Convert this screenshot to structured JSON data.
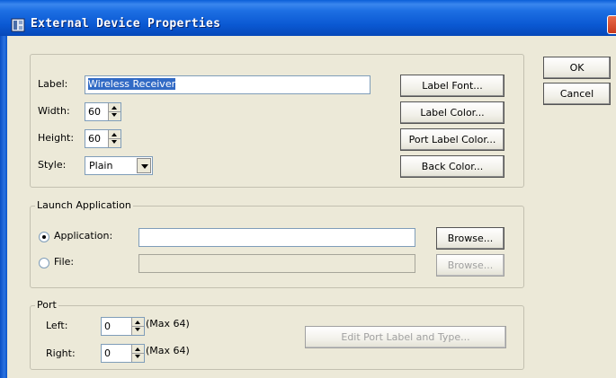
{
  "window": {
    "title": "External Device Properties",
    "ok_label": "OK",
    "cancel_label": "Cancel"
  },
  "general": {
    "label_caption": "Label:",
    "label_value": "Wireless Receiver",
    "width_caption": "Width:",
    "width_value": "60",
    "height_caption": "Height:",
    "height_value": "60",
    "style_caption": "Style:",
    "style_value": "Plain",
    "label_font_button": "Label Font...",
    "label_color_button": "Label Color...",
    "port_label_color_button": "Port Label Color...",
    "back_color_button": "Back Color..."
  },
  "launch": {
    "group_title": "Launch Application",
    "application_label": "Application:",
    "application_value": "",
    "file_label": "File:",
    "file_value": "",
    "selected": "application",
    "browse_label": "Browse...",
    "browse_file_label": "Browse..."
  },
  "port": {
    "group_title": "Port",
    "left_caption": "Left:",
    "left_value": "0",
    "left_max": "(Max 64)",
    "right_caption": "Right:",
    "right_value": "0",
    "right_max": "(Max 64)",
    "edit_button": "Edit Port Label and Type..."
  },
  "colors": {
    "title_bar": "#0a58d2",
    "dialog_bg": "#ece9d8",
    "selection": "#316ac5"
  },
  "icons": {
    "title": "device-properties-icon",
    "close": "close-icon"
  }
}
